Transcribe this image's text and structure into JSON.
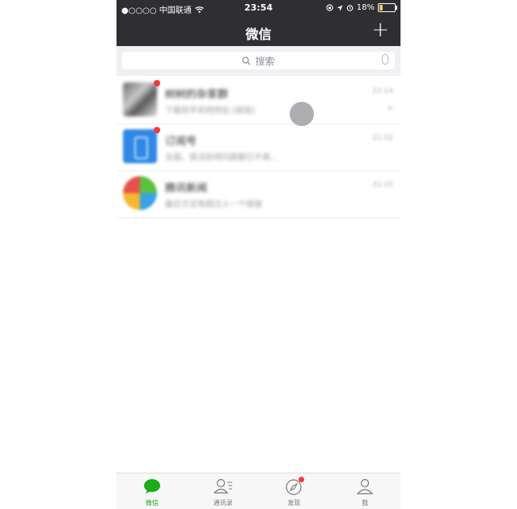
{
  "status_bar": {
    "carrier": "●○○○○ 中国联通",
    "time": "23:54",
    "battery": "18%"
  },
  "nav": {
    "title": "微信",
    "add_symbol": "+"
  },
  "search": {
    "placeholder": "搜索"
  },
  "chats": [
    {
      "name": "树树的杂家群",
      "message": "下载到手机吧然后 [链接]",
      "time": "22:14",
      "muted": "※"
    },
    {
      "name": "订阅号",
      "message": "全国，我活跃吧问题都已不离…",
      "time": "21:52",
      "muted": ""
    },
    {
      "name": "腾讯新闻",
      "message": "最近才还有超过人一个链接",
      "time": "21:20",
      "muted": ""
    }
  ],
  "tabs": [
    {
      "label": "微信",
      "icon": "chat-bubble-icon",
      "active": true
    },
    {
      "label": "通讯录",
      "icon": "contacts-icon",
      "active": false
    },
    {
      "label": "发现",
      "icon": "compass-icon",
      "active": false,
      "badge": true
    },
    {
      "label": "我",
      "icon": "person-icon",
      "active": false
    }
  ],
  "colors": {
    "navbar": "#2e2e33",
    "accent_green": "#1aad19",
    "badge_red": "#f23b3b"
  }
}
